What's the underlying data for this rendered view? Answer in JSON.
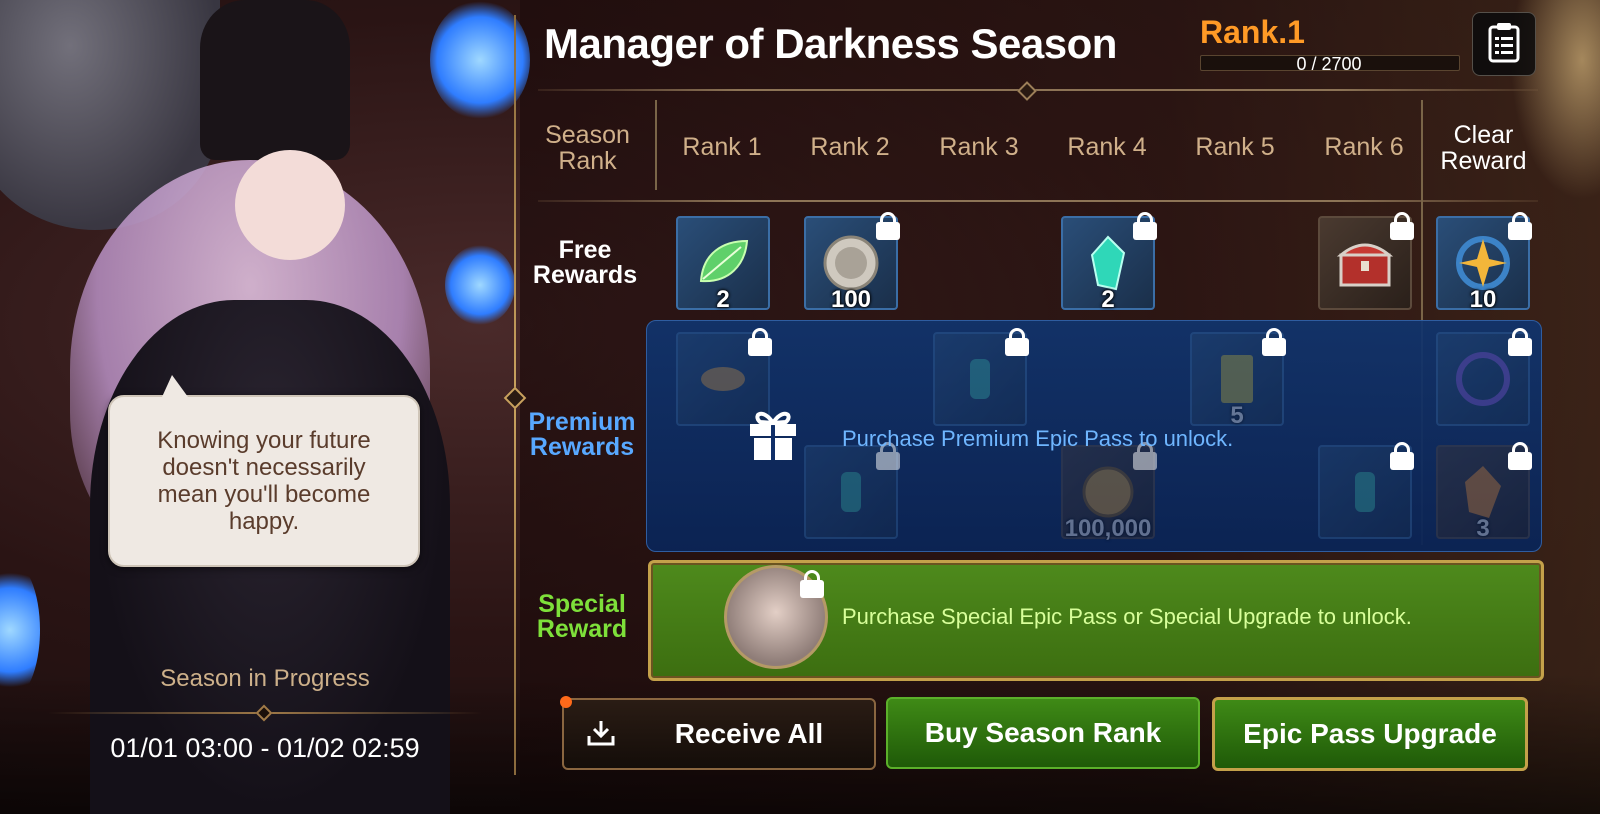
{
  "header": {
    "title": "Manager of Darkness Season",
    "current_rank": "Rank.1",
    "progress_text": "0 / 2700",
    "progress_value": 0,
    "progress_max": 2700
  },
  "columns": {
    "season_rank_label": "Season Rank",
    "ranks": [
      "Rank 1",
      "Rank 2",
      "Rank 3",
      "Rank 4",
      "Rank 5",
      "Rank 6"
    ],
    "clear_reward_label": "Clear Reward"
  },
  "rows": {
    "free": "Free Rewards",
    "premium": "Premium Rewards",
    "special": "Special Reward"
  },
  "free_rewards": [
    {
      "rank": "Rank 1",
      "icon": "leaf-icon",
      "qty": "2",
      "locked": false
    },
    {
      "rank": "Rank 2",
      "icon": "coin-icon",
      "qty": "100",
      "locked": true
    },
    {
      "rank": "Rank 4",
      "icon": "crystal-icon",
      "qty": "2",
      "locked": true
    },
    {
      "rank": "Rank 6",
      "icon": "chest-icon",
      "qty": "",
      "locked": true
    },
    {
      "rank": "Clear Reward",
      "icon": "star-charm-icon",
      "qty": "10",
      "locked": true
    }
  ],
  "premium_rewards_top": [
    {
      "rank": "Rank 1",
      "icon": "fish-icon",
      "qty": ""
    },
    {
      "rank": "Rank 3",
      "icon": "potion-icon",
      "qty": ""
    },
    {
      "rank": "Rank 5",
      "icon": "card-icon",
      "qty": "5"
    },
    {
      "rank": "Clear Reward",
      "icon": "frame-icon",
      "qty": ""
    }
  ],
  "premium_rewards_bottom": [
    {
      "rank": "Rank 2",
      "icon": "potion-icon",
      "qty": ""
    },
    {
      "rank": "Rank 4",
      "icon": "gold-coin-icon",
      "qty": "100,000"
    },
    {
      "rank": "Rank 6",
      "icon": "potion-icon",
      "qty": ""
    },
    {
      "rank": "Clear Reward",
      "icon": "orange-crystal-icon",
      "qty": "3"
    }
  ],
  "premium_message": "Purchase Premium Epic Pass to unlock.",
  "special_message": "Purchase Special Epic Pass or Special Upgrade to unlock.",
  "speech": "Knowing your future doesn't necessarily mean you'll become happy.",
  "season": {
    "status": "Season in Progress",
    "dates": "01/01 03:00 - 01/02 02:59"
  },
  "buttons": {
    "receive_all": "Receive All",
    "buy_season_rank": "Buy Season Rank",
    "epic_pass_upgrade": "Epic Pass Upgrade"
  },
  "colors": {
    "rank_orange": "#ff9a26",
    "premium_blue": "#58a8ff",
    "special_green": "#7ee03a",
    "gold_border": "#c4a14a"
  }
}
